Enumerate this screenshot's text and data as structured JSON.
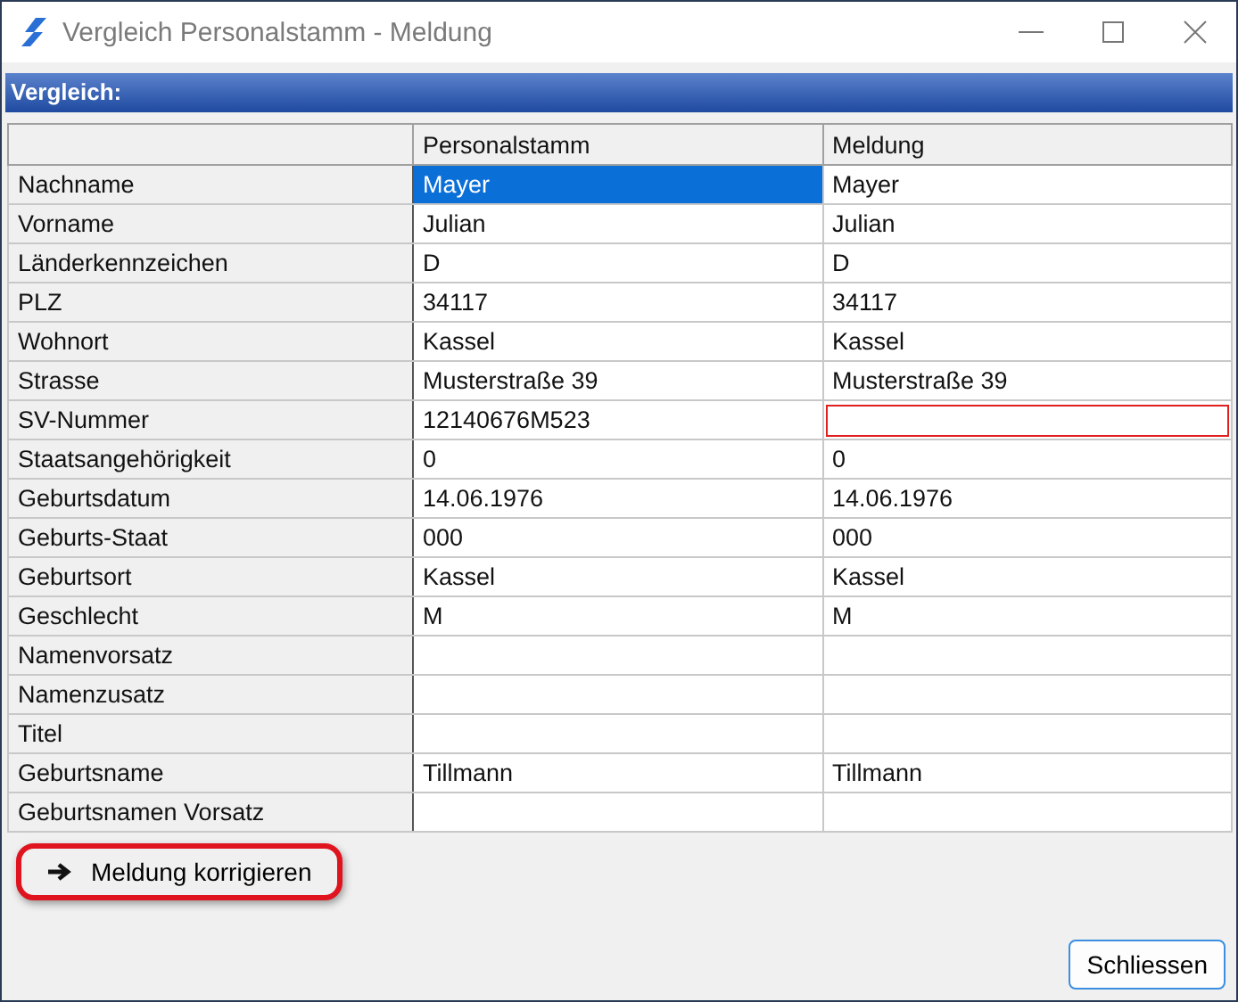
{
  "window": {
    "title": "Vergleich Personalstamm - Meldung"
  },
  "section": {
    "title": "Vergleich:"
  },
  "table": {
    "columns": [
      "Personalstamm",
      "Meldung"
    ],
    "rows": [
      {
        "label": "Nachname",
        "cells": [
          {
            "value": "Mayer",
            "selected": true,
            "error": false
          },
          {
            "value": "Mayer",
            "selected": false,
            "error": false
          }
        ]
      },
      {
        "label": "Vorname",
        "cells": [
          {
            "value": "Julian",
            "selected": false,
            "error": false
          },
          {
            "value": "Julian",
            "selected": false,
            "error": false
          }
        ]
      },
      {
        "label": "Länderkennzeichen",
        "cells": [
          {
            "value": "D",
            "selected": false,
            "error": false
          },
          {
            "value": "D",
            "selected": false,
            "error": false
          }
        ]
      },
      {
        "label": "PLZ",
        "cells": [
          {
            "value": "34117",
            "selected": false,
            "error": false
          },
          {
            "value": "34117",
            "selected": false,
            "error": false
          }
        ]
      },
      {
        "label": "Wohnort",
        "cells": [
          {
            "value": "Kassel",
            "selected": false,
            "error": false
          },
          {
            "value": "Kassel",
            "selected": false,
            "error": false
          }
        ]
      },
      {
        "label": "Strasse",
        "cells": [
          {
            "value": "Musterstraße 39",
            "selected": false,
            "error": false
          },
          {
            "value": "Musterstraße 39",
            "selected": false,
            "error": false
          }
        ]
      },
      {
        "label": "SV-Nummer",
        "cells": [
          {
            "value": "12140676M523",
            "selected": false,
            "error": false
          },
          {
            "selected": false,
            "error": true
          }
        ]
      },
      {
        "label": "Staatsangehörigkeit",
        "cells": [
          {
            "value": "0",
            "selected": false,
            "error": false
          },
          {
            "value": "0",
            "selected": false,
            "error": false
          }
        ]
      },
      {
        "label": "Geburtsdatum",
        "cells": [
          {
            "value": "14.06.1976",
            "selected": false,
            "error": false
          },
          {
            "value": "14.06.1976",
            "selected": false,
            "error": false
          }
        ]
      },
      {
        "label": "Geburts-Staat",
        "cells": [
          {
            "value": "000",
            "selected": false,
            "error": false
          },
          {
            "value": "000",
            "selected": false,
            "error": false
          }
        ]
      },
      {
        "label": "Geburtsort",
        "cells": [
          {
            "value": "Kassel",
            "selected": false,
            "error": false
          },
          {
            "value": "Kassel",
            "selected": false,
            "error": false
          }
        ]
      },
      {
        "label": "Geschlecht",
        "cells": [
          {
            "value": "M",
            "selected": false,
            "error": false
          },
          {
            "value": "M",
            "selected": false,
            "error": false
          }
        ]
      },
      {
        "label": "Namenvorsatz",
        "cells": [
          {
            "selected": false,
            "error": false
          },
          {
            "selected": false,
            "error": false
          }
        ]
      },
      {
        "label": "Namenzusatz",
        "cells": [
          {
            "selected": false,
            "error": false
          },
          {
            "selected": false,
            "error": false
          }
        ]
      },
      {
        "label": "Titel",
        "cells": [
          {
            "selected": false,
            "error": false
          },
          {
            "selected": false,
            "error": false
          }
        ]
      },
      {
        "label": "Geburtsname",
        "cells": [
          {
            "value": "Tillmann",
            "selected": false,
            "error": false
          },
          {
            "value": "Tillmann",
            "selected": false,
            "error": false
          }
        ]
      },
      {
        "label": "Geburtsnamen Vorsatz",
        "cells": [
          {
            "selected": false,
            "error": false
          },
          {
            "selected": false,
            "error": false
          }
        ]
      }
    ]
  },
  "buttons": [
    {
      "kind": "action",
      "label": "Meldung korrigieren",
      "highlighted": true
    },
    {
      "kind": "close",
      "label": "Schliessen"
    }
  ]
}
